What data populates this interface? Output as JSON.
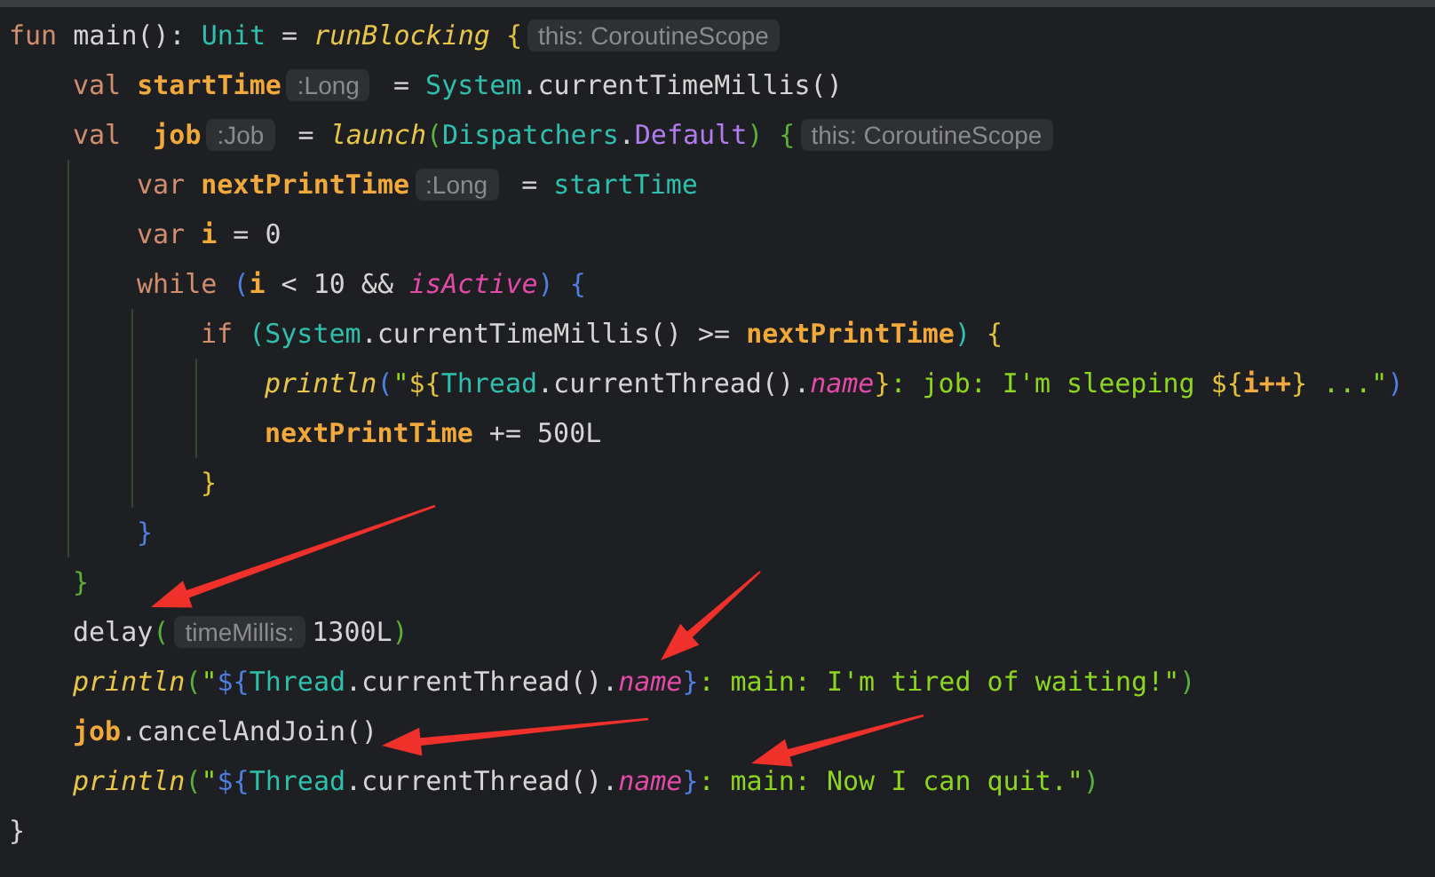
{
  "editor": {
    "lines": [
      {
        "tokens": [
          {
            "kind": "kw",
            "text": "fun"
          },
          {
            "kind": "plain",
            "text": " main(): "
          },
          {
            "kind": "type",
            "text": "Unit"
          },
          {
            "kind": "plain",
            "text": " = "
          },
          {
            "kind": "fn",
            "text": "runBlocking"
          },
          {
            "kind": "yellow",
            "text": " {"
          },
          {
            "kind": "hint",
            "text": "this: CoroutineScope"
          }
        ],
        "children": [
          {
            "tokens": [
              {
                "kind": "kw",
                "text": "val "
              },
              {
                "kind": "decl",
                "text": "startTime"
              },
              {
                "kind": "hint",
                "text": ":Long"
              },
              {
                "kind": "plain",
                "text": " = "
              },
              {
                "kind": "type",
                "text": "System"
              },
              {
                "kind": "plain",
                "text": ".currentTimeMillis()"
              }
            ]
          },
          {
            "tokens": [
              {
                "kind": "kw",
                "text": "val "
              },
              {
                "kind": "decl",
                "text": " job"
              },
              {
                "kind": "hint",
                "text": ":Job"
              },
              {
                "kind": "plain",
                "text": " = "
              },
              {
                "kind": "fn",
                "text": "launch"
              },
              {
                "kind": "green",
                "text": "("
              },
              {
                "kind": "type",
                "text": "Dispatchers"
              },
              {
                "kind": "plain",
                "text": "."
              },
              {
                "kind": "prop",
                "text": "Default"
              },
              {
                "kind": "green",
                "text": ")"
              },
              {
                "kind": "green",
                "text": " {"
              },
              {
                "kind": "hint",
                "text": "this: CoroutineScope"
              }
            ],
            "children": [
              {
                "tokens": [
                  {
                    "kind": "kw",
                    "text": "var "
                  },
                  {
                    "kind": "decl",
                    "text": "nextPrintTime"
                  },
                  {
                    "kind": "hint",
                    "text": ":Long"
                  },
                  {
                    "kind": "plain",
                    "text": " = "
                  },
                  {
                    "kind": "type",
                    "text": "startTime"
                  }
                ]
              },
              {
                "tokens": [
                  {
                    "kind": "kw",
                    "text": "var "
                  },
                  {
                    "kind": "decl",
                    "text": "i"
                  },
                  {
                    "kind": "plain",
                    "text": " = 0"
                  }
                ]
              },
              {
                "tokens": [
                  {
                    "kind": "kw",
                    "text": "while "
                  },
                  {
                    "kind": "blue",
                    "text": "("
                  },
                  {
                    "kind": "decl",
                    "text": "i"
                  },
                  {
                    "kind": "plain",
                    "text": " < 10 && "
                  },
                  {
                    "kind": "member",
                    "text": "isActive"
                  },
                  {
                    "kind": "blue",
                    "text": ")"
                  },
                  {
                    "kind": "blue",
                    "text": " {"
                  }
                ],
                "children": [
                  {
                    "tokens": [
                      {
                        "kind": "kw",
                        "text": "if "
                      },
                      {
                        "kind": "type",
                        "text": "("
                      },
                      {
                        "kind": "type",
                        "text": "System"
                      },
                      {
                        "kind": "plain",
                        "text": ".currentTimeMillis() >= "
                      },
                      {
                        "kind": "decl",
                        "text": "nextPrintTime"
                      },
                      {
                        "kind": "type",
                        "text": ")"
                      },
                      {
                        "kind": "yellow",
                        "text": " {"
                      }
                    ],
                    "children": [
                      {
                        "tokens": [
                          {
                            "kind": "fn",
                            "text": "println"
                          },
                          {
                            "kind": "blue",
                            "text": "("
                          },
                          {
                            "kind": "str",
                            "text": "\""
                          },
                          {
                            "kind": "yellow",
                            "text": "${"
                          },
                          {
                            "kind": "type",
                            "text": "Thread"
                          },
                          {
                            "kind": "plain",
                            "text": ".currentThread()."
                          },
                          {
                            "kind": "member",
                            "text": "name"
                          },
                          {
                            "kind": "yellow",
                            "text": "}"
                          },
                          {
                            "kind": "str",
                            "text": ": job: I'm sleeping "
                          },
                          {
                            "kind": "yellow",
                            "text": "${"
                          },
                          {
                            "kind": "decl",
                            "text": "i++"
                          },
                          {
                            "kind": "yellow",
                            "text": "}"
                          },
                          {
                            "kind": "str",
                            "text": " ...\""
                          },
                          {
                            "kind": "blue",
                            "text": ")"
                          }
                        ]
                      },
                      {
                        "tokens": [
                          {
                            "kind": "decl",
                            "text": "nextPrintTime"
                          },
                          {
                            "kind": "plain",
                            "text": " += 500L"
                          }
                        ]
                      }
                    ]
                  },
                  {
                    "tokens": [
                      {
                        "kind": "yellow",
                        "text": "}"
                      }
                    ]
                  }
                ]
              },
              {
                "tokens": [
                  {
                    "kind": "blue",
                    "text": "}"
                  }
                ]
              }
            ]
          },
          {
            "tokens": [
              {
                "kind": "green",
                "text": "}"
              }
            ]
          },
          {
            "tokens": [
              {
                "kind": "plain",
                "text": "delay"
              },
              {
                "kind": "green",
                "text": "("
              },
              {
                "kind": "hint",
                "text": "timeMillis:"
              },
              {
                "kind": "plain",
                "text": "1300L"
              },
              {
                "kind": "green",
                "text": ")"
              }
            ]
          },
          {
            "tokens": [
              {
                "kind": "fn",
                "text": "println"
              },
              {
                "kind": "green",
                "text": "("
              },
              {
                "kind": "str",
                "text": "\""
              },
              {
                "kind": "blue",
                "text": "${"
              },
              {
                "kind": "type",
                "text": "Thread"
              },
              {
                "kind": "plain",
                "text": ".currentThread()."
              },
              {
                "kind": "member",
                "text": "name"
              },
              {
                "kind": "blue",
                "text": "}"
              },
              {
                "kind": "str",
                "text": ": main: I'm tired of waiting!\""
              },
              {
                "kind": "green",
                "text": ")"
              }
            ]
          },
          {
            "tokens": [
              {
                "kind": "decl",
                "text": "job"
              },
              {
                "kind": "plain",
                "text": ".cancelAndJoin()"
              }
            ]
          },
          {
            "tokens": [
              {
                "kind": "fn",
                "text": "println"
              },
              {
                "kind": "green",
                "text": "("
              },
              {
                "kind": "str",
                "text": "\""
              },
              {
                "kind": "blue",
                "text": "${"
              },
              {
                "kind": "type",
                "text": "Thread"
              },
              {
                "kind": "plain",
                "text": ".currentThread()."
              },
              {
                "kind": "member",
                "text": "name"
              },
              {
                "kind": "blue",
                "text": "}"
              },
              {
                "kind": "str",
                "text": ": main: Now I can quit.\""
              },
              {
                "kind": "green",
                "text": ")"
              }
            ]
          }
        ]
      },
      {
        "tokens": [
          {
            "kind": "plain",
            "text": "}"
          }
        ]
      }
    ]
  }
}
